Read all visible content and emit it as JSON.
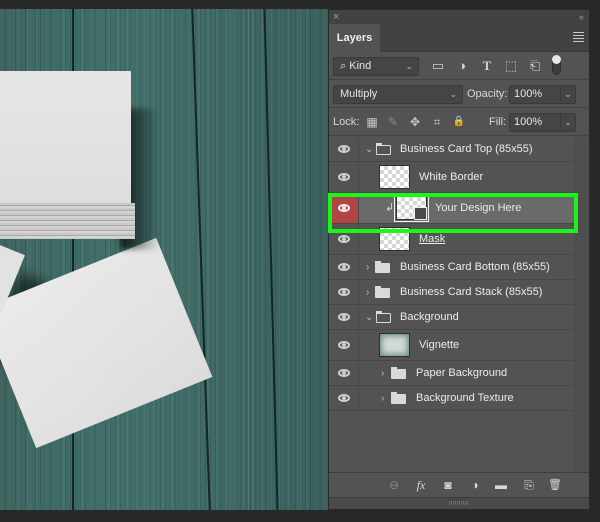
{
  "panel": {
    "tab_label": "Layers",
    "close_glyph": "×",
    "collapse_glyph": "‹‹"
  },
  "filter": {
    "search_glyph": "⌕",
    "kind_label": "Kind",
    "chevron": "⌄",
    "filter_icons": [
      "image-filter-icon",
      "adjustment-filter-icon",
      "type-filter-icon",
      "shape-filter-icon",
      "smart-object-filter-icon"
    ],
    "filter_glyphs": [
      "▭",
      "◑",
      "T",
      "⬚",
      "⎗"
    ]
  },
  "blend": {
    "mode": "Multiply",
    "opacity_label": "Opacity:",
    "opacity_value": "100%"
  },
  "lock": {
    "label": "Lock:",
    "glyphs": [
      "▦",
      "✎",
      "✥",
      "⌗",
      "🔒"
    ],
    "fill_label": "Fill:",
    "fill_value": "100%"
  },
  "layers": [
    {
      "name": "Business Card Top (85x55)",
      "type": "group",
      "expanded": true,
      "indent": 0,
      "visible": true
    },
    {
      "name": "White Border",
      "type": "pixel",
      "indent": 1,
      "visible": true
    },
    {
      "name": "Your Design Here",
      "type": "smart-object",
      "indent": 1,
      "clipped": true,
      "selected": true,
      "visible": true
    },
    {
      "name": "Mask",
      "type": "pixel",
      "indent": 1,
      "visible": true,
      "underlined": true
    },
    {
      "name": "Business Card Bottom (85x55)",
      "type": "group",
      "expanded": false,
      "indent": 0,
      "visible": true
    },
    {
      "name": "Business Card Stack (85x55)",
      "type": "group",
      "expanded": false,
      "indent": 0,
      "visible": true
    },
    {
      "name": "Background",
      "type": "group",
      "expanded": true,
      "indent": 0,
      "visible": true
    },
    {
      "name": "Vignette",
      "type": "pixel",
      "indent": 1,
      "visible": true
    },
    {
      "name": "Paper Background",
      "type": "group",
      "expanded": false,
      "indent": 1,
      "visible": true
    },
    {
      "name": "Background Texture",
      "type": "group",
      "expanded": false,
      "indent": 1,
      "visible": true
    }
  ],
  "disclosure": {
    "open": "⌄",
    "closed": "›"
  },
  "clip_glyph": "↲",
  "bottom_bar": {
    "glyphs": [
      "⊖",
      "fx",
      "◙",
      "◑",
      "▬",
      "⎘",
      "🗑"
    ]
  },
  "colors": {
    "highlight": "#1bf51b",
    "selected_eye_bg": "#b14545",
    "panel_bg": "#535353"
  }
}
